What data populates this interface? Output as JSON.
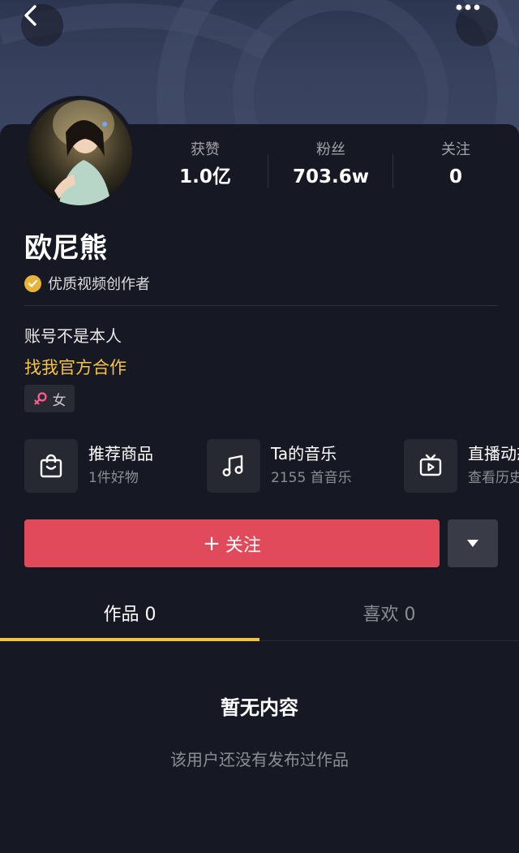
{
  "header": {
    "back_icon": "chevron-left-icon",
    "more_icon": "ellipsis-icon"
  },
  "profile": {
    "name": "欧尼熊",
    "certification": "优质视频创作者",
    "bio": "账号不是本人",
    "bio_link": "找我官方合作",
    "gender": "女"
  },
  "stats": [
    {
      "label": "获赞",
      "value": "1.0亿"
    },
    {
      "label": "粉丝",
      "value": "703.6w"
    },
    {
      "label": "关注",
      "value": "0"
    }
  ],
  "services": [
    {
      "icon": "shopping-bag-icon",
      "title": "推荐商品",
      "subtitle": "1件好物"
    },
    {
      "icon": "music-note-icon",
      "title": "Ta的音乐",
      "subtitle": "2155 首音乐"
    },
    {
      "icon": "tv-play-icon",
      "title": "直播动态",
      "subtitle": "查看历史"
    }
  ],
  "actions": {
    "follow_label": "关注",
    "follow_prefix": "+"
  },
  "tabs": [
    {
      "label": "作品 0",
      "active": true
    },
    {
      "label": "喜欢 0",
      "active": false
    }
  ],
  "empty": {
    "title": "暂无内容",
    "subtitle": "该用户还没有发布过作品"
  },
  "colors": {
    "background": "#161823",
    "accent": "#f5c344",
    "follow": "#e04a5a",
    "cert_badge": "#e8b339",
    "gender": "#ff5d8f"
  }
}
